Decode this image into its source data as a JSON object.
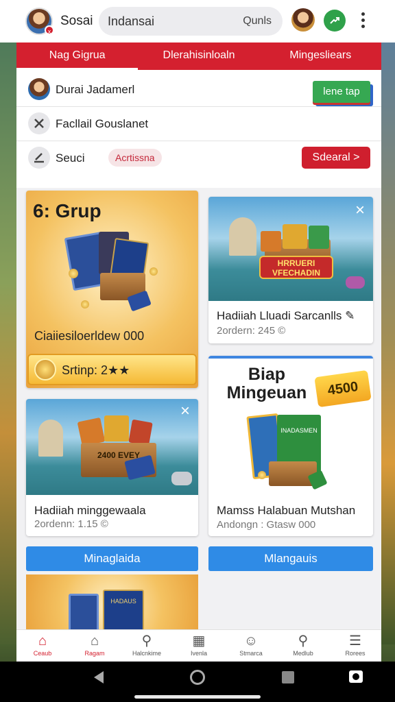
{
  "header": {
    "app_name": "Sosai",
    "search_value": "Indansai",
    "search_hint": "Qunls",
    "avatar_badge": "x"
  },
  "tabs": [
    {
      "label": "Nag Gigrua",
      "active": true
    },
    {
      "label": "Dlerahisinloaln",
      "active": false
    },
    {
      "label": "Mingesliears",
      "active": false
    }
  ],
  "notifications": [
    {
      "text": "Durai Jadamerl",
      "button": "lene tap"
    },
    {
      "text": "Facllail Gouslanet"
    },
    {
      "text": "Seuci",
      "chip": "Acrtissna",
      "button": "Sdearal >"
    }
  ],
  "cards": {
    "featured": {
      "title": "6: Grup",
      "caption": "Ciaiiesiloerldew 000",
      "pill": "Srtinp: 2★★"
    },
    "top_right": {
      "caption": "Hadiiah Lluadi Sarcanlls ✎",
      "sub": "2ordern: 245 ©"
    },
    "bottom_left": {
      "caption": "Hadiiah minggewaala",
      "sub": "2ordenn: 1.15 ©"
    },
    "promo": {
      "title": "Biap Mingeuan",
      "tag": "4500",
      "caption": "Mamss Halabuan Mutshan",
      "sub": "Andongn : Gtasw 000"
    }
  },
  "buttons": {
    "left": "Minaglaida",
    "right": "Mlangauis"
  },
  "art_text": {
    "chest_label": "2400 EVEY",
    "banner": "HRRUERI VFECHADIN",
    "book_label": "INADASMEN",
    "book_label_2": "HADAUS",
    "close_glyph": "×"
  },
  "nav": [
    {
      "icon": "home-icon",
      "label": "Ceaub",
      "active": true
    },
    {
      "icon": "store-icon",
      "label": "Ragam",
      "active": true
    },
    {
      "icon": "search-icon",
      "label": "Halcnkime",
      "active": false
    },
    {
      "icon": "grid-icon",
      "label": "Ivenla",
      "active": false
    },
    {
      "icon": "profile-icon",
      "label": "Stmarca",
      "active": false
    },
    {
      "icon": "search-icon",
      "label": "Medlub",
      "active": false
    },
    {
      "icon": "menu-icon",
      "label": "Rorees",
      "active": false
    }
  ],
  "colors": {
    "brand_red": "#d4202f",
    "action_blue": "#2f8be6",
    "success_green": "#36a852"
  }
}
